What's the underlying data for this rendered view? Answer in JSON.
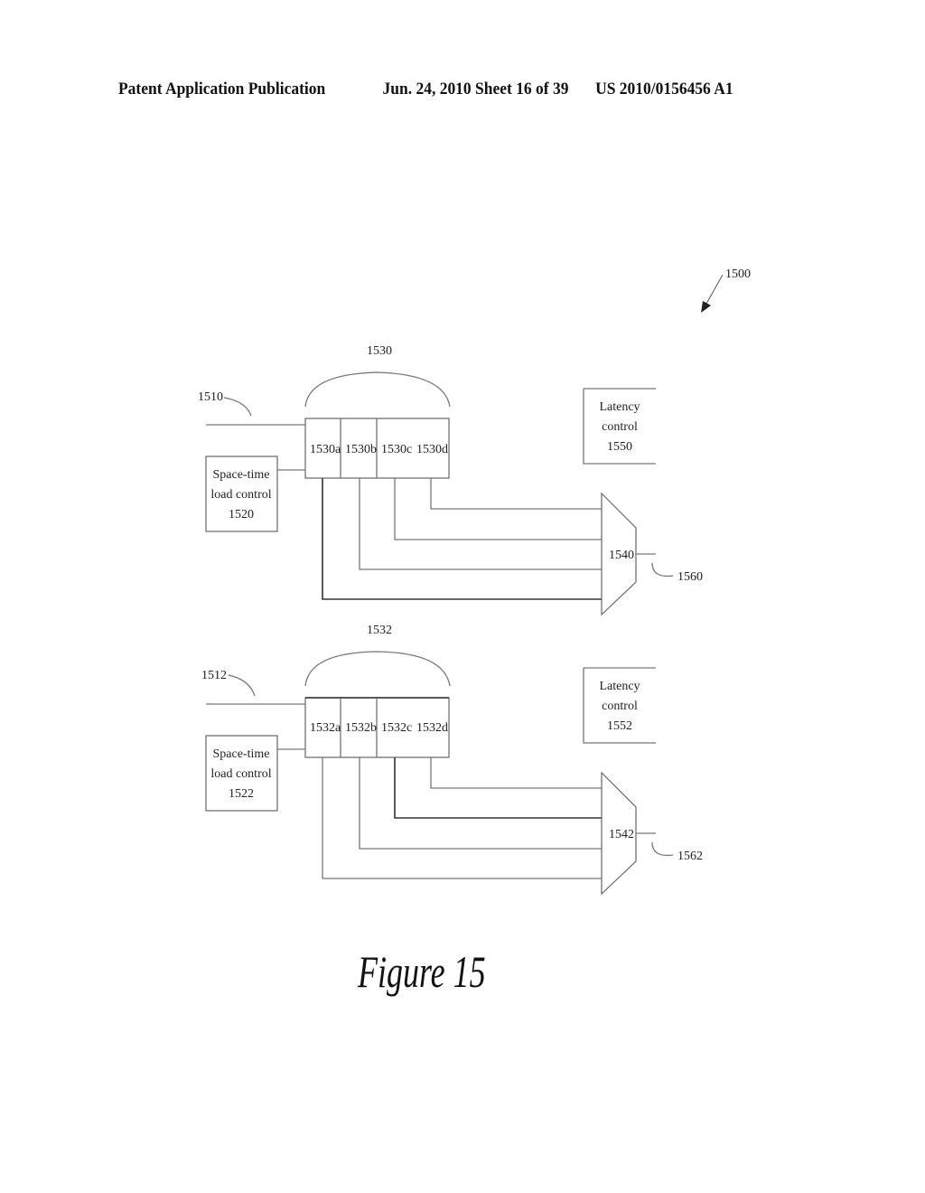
{
  "header": {
    "publication": "Patent Application Publication",
    "date_sheet": "Jun. 24, 2010  Sheet 16 of 39",
    "patent_number": "US 2010/0156456 A1"
  },
  "figure": {
    "ref": "1500",
    "caption": "Figure 15",
    "groups": [
      {
        "input_ref": "1510",
        "buffer_ref": "1530",
        "slots": [
          "1530a",
          "1530b",
          "1530c",
          "1530d"
        ],
        "load_control": {
          "line1": "Space-time",
          "line2": "load control",
          "ref": "1520"
        },
        "latency_control": {
          "line1": "Latency",
          "line2": "control",
          "ref": "1550"
        },
        "mux_ref": "1540",
        "output_ref": "1560"
      },
      {
        "input_ref": "1512",
        "buffer_ref": "1532",
        "slots": [
          "1532a",
          "1532b",
          "1532c",
          "1532d"
        ],
        "load_control": {
          "line1": "Space-time",
          "line2": "load control",
          "ref": "1522"
        },
        "latency_control": {
          "line1": "Latency",
          "line2": "control",
          "ref": "1552"
        },
        "mux_ref": "1542",
        "output_ref": "1562"
      }
    ]
  }
}
